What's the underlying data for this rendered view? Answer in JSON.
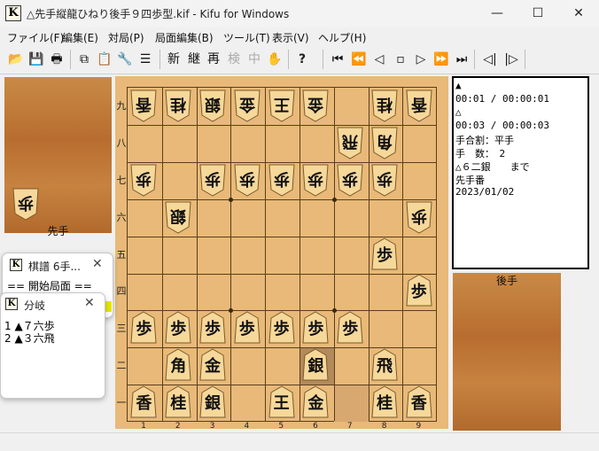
{
  "window": {
    "title": "△先手縦龍ひねり後手９四歩型.kif - Kifu for Windows",
    "app_icon_letter": "K",
    "minimize_glyph": "—",
    "maximize_glyph": "☐",
    "close_glyph": "✕"
  },
  "menu": [
    "ファイル(F)",
    "編集(E)",
    "対局(P)",
    "局面編集(B)",
    "ツール(T)",
    "表示(V)",
    "ヘルプ(H)"
  ],
  "toolbar": {
    "open_glyph": "📂",
    "save_glyph": "💾",
    "print_glyph": "🖶",
    "copy_glyph": "⧉",
    "paste_glyph": "📋",
    "tools_glyph": "🔧",
    "list_glyph": "☰",
    "new_label": "新",
    "continue_label": "継",
    "replay_label": "再",
    "review_label": "検",
    "interrupt_label": "中",
    "hand_glyph": "✋",
    "help_glyph": "?",
    "first_glyph": "⏮",
    "back10_glyph": "⏪",
    "back_glyph": "◁",
    "stop_glyph": "▫",
    "forward_glyph": "▷",
    "fwd10_glyph": "⏩",
    "last_glyph": "⏭",
    "prev_branch_glyph": "◁|",
    "next_branch_glyph": "|▷"
  },
  "board": {
    "ranks": [
      "九",
      "八",
      "七",
      "六",
      "五",
      "四",
      "三",
      "二",
      "一"
    ],
    "files": [
      "1",
      "2",
      "3",
      "4",
      "5",
      "6",
      "7",
      "8",
      "9"
    ],
    "pieces": [
      {
        "r": 0,
        "c": 0,
        "ch": "香",
        "side": "gote"
      },
      {
        "r": 0,
        "c": 1,
        "ch": "桂",
        "side": "gote"
      },
      {
        "r": 0,
        "c": 2,
        "ch": "銀",
        "side": "gote"
      },
      {
        "r": 0,
        "c": 3,
        "ch": "金",
        "side": "gote"
      },
      {
        "r": 0,
        "c": 4,
        "ch": "王",
        "side": "gote"
      },
      {
        "r": 0,
        "c": 5,
        "ch": "金",
        "side": "gote"
      },
      {
        "r": 0,
        "c": 7,
        "ch": "桂",
        "side": "gote"
      },
      {
        "r": 0,
        "c": 8,
        "ch": "香",
        "side": "gote"
      },
      {
        "r": 1,
        "c": 6,
        "ch": "飛",
        "side": "gote"
      },
      {
        "r": 1,
        "c": 7,
        "ch": "角",
        "side": "gote"
      },
      {
        "r": 2,
        "c": 0,
        "ch": "歩",
        "side": "gote"
      },
      {
        "r": 2,
        "c": 2,
        "ch": "歩",
        "side": "gote"
      },
      {
        "r": 2,
        "c": 3,
        "ch": "歩",
        "side": "gote"
      },
      {
        "r": 2,
        "c": 4,
        "ch": "歩",
        "side": "gote"
      },
      {
        "r": 2,
        "c": 5,
        "ch": "歩",
        "side": "gote"
      },
      {
        "r": 2,
        "c": 6,
        "ch": "歩",
        "side": "gote"
      },
      {
        "r": 2,
        "c": 7,
        "ch": "歩",
        "side": "gote"
      },
      {
        "r": 3,
        "c": 1,
        "ch": "銀",
        "side": "gote"
      },
      {
        "r": 3,
        "c": 8,
        "ch": "歩",
        "side": "gote"
      },
      {
        "r": 4,
        "c": 7,
        "ch": "歩",
        "side": "sente"
      },
      {
        "r": 5,
        "c": 8,
        "ch": "歩",
        "side": "sente"
      },
      {
        "r": 6,
        "c": 0,
        "ch": "歩",
        "side": "sente"
      },
      {
        "r": 6,
        "c": 1,
        "ch": "歩",
        "side": "sente"
      },
      {
        "r": 6,
        "c": 2,
        "ch": "歩",
        "side": "sente"
      },
      {
        "r": 6,
        "c": 3,
        "ch": "歩",
        "side": "sente"
      },
      {
        "r": 6,
        "c": 4,
        "ch": "歩",
        "side": "sente"
      },
      {
        "r": 6,
        "c": 5,
        "ch": "歩",
        "side": "sente"
      },
      {
        "r": 6,
        "c": 6,
        "ch": "歩",
        "side": "sente"
      },
      {
        "r": 7,
        "c": 1,
        "ch": "角",
        "side": "sente"
      },
      {
        "r": 7,
        "c": 2,
        "ch": "金",
        "side": "sente"
      },
      {
        "r": 7,
        "c": 5,
        "ch": "銀",
        "side": "sente"
      },
      {
        "r": 7,
        "c": 7,
        "ch": "飛",
        "side": "sente"
      },
      {
        "r": 8,
        "c": 0,
        "ch": "香",
        "side": "sente"
      },
      {
        "r": 8,
        "c": 1,
        "ch": "桂",
        "side": "sente"
      },
      {
        "r": 8,
        "c": 2,
        "ch": "銀",
        "side": "sente"
      },
      {
        "r": 8,
        "c": 4,
        "ch": "王",
        "side": "sente"
      },
      {
        "r": 8,
        "c": 5,
        "ch": "金",
        "side": "sente"
      },
      {
        "r": 8,
        "c": 7,
        "ch": "桂",
        "side": "sente"
      },
      {
        "r": 8,
        "c": 8,
        "ch": "香",
        "side": "sente"
      }
    ],
    "highlight_colors": {
      "last_move": "#b38a5c",
      "from_square": "#d7a870"
    }
  },
  "sente_stand": {
    "label": "先手",
    "pieces": [
      {
        "ch": "歩",
        "side": "gote"
      }
    ]
  },
  "gote_stand": {
    "label": "後手"
  },
  "info": {
    "lines": [
      "▲",
      "00:01 / 00:00:01",
      "△",
      "00:03 / 00:00:03",
      "手合割：平手",
      "手　数：　2",
      "△６二銀　　まで",
      "先手番",
      "2023/01/02"
    ]
  },
  "kifu_pane": {
    "title": "棋譜 6手...",
    "close_glyph": "✕",
    "first_line": "==  開始局面  =="
  },
  "branch_pane": {
    "title": "分岐",
    "close_glyph": "✕",
    "items": [
      "1 ▲７六歩",
      "2 ▲３六飛"
    ]
  },
  "colors": {
    "board": "#e8b978",
    "stand": "#b86d2f",
    "piece_fill": "#f6d89a",
    "kifu_mark": "#e6e600"
  }
}
